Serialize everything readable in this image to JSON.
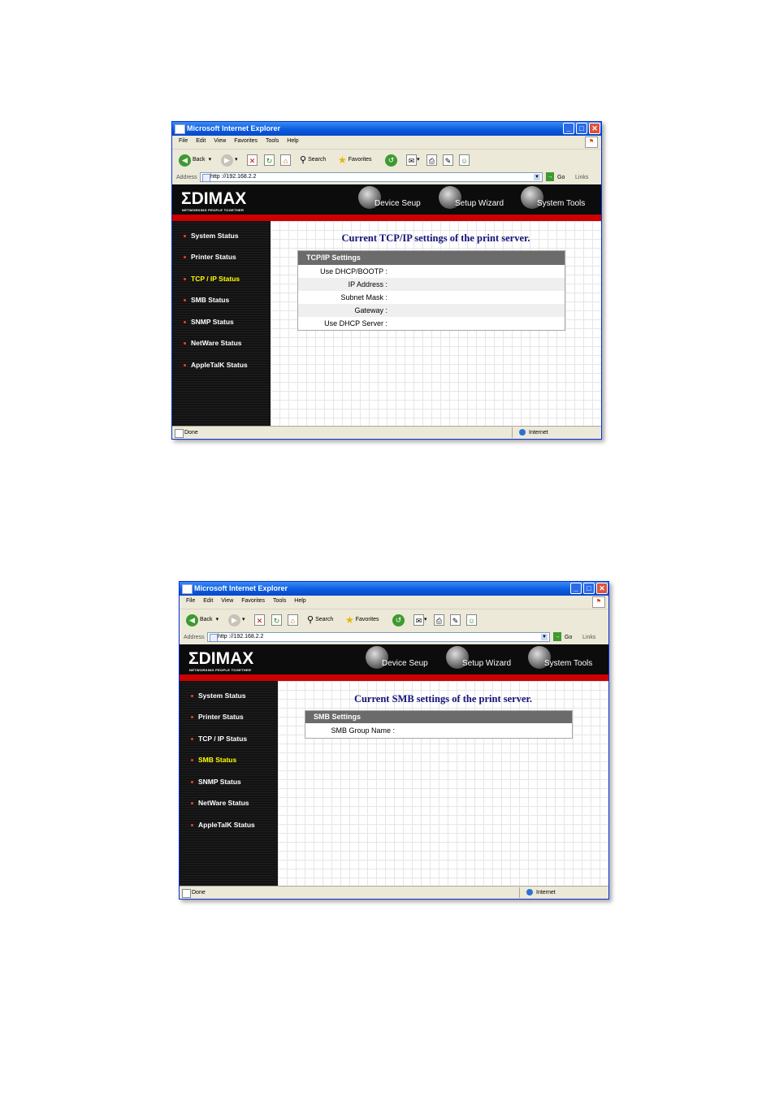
{
  "windows": [
    {
      "title": "Microsoft Internet Explorer",
      "menu": [
        "File",
        "Edit",
        "View",
        "Favorites",
        "Tools",
        "Help"
      ],
      "toolbar": {
        "back": "Back",
        "search": "Search",
        "favorites": "Favorites"
      },
      "address": {
        "label": "Address",
        "url": "http ://192.168.2.2",
        "go": "Go",
        "links": "Links"
      },
      "banner": {
        "logo": "ΣDIMAX",
        "tagline": "NETWORKING PEOPLE TOGETHER",
        "nav": [
          "Device Seup",
          "Setup Wizard",
          "System Tools"
        ]
      },
      "sidebar": [
        "System Status",
        "Printer Status",
        "TCP / IP Status",
        "SMB Status",
        "SNMP Status",
        "NetWare Status",
        "AppleTalK Status"
      ],
      "active_item": "TCP / IP Status",
      "main": {
        "title": "Current TCP/IP settings of the print server.",
        "table_header": "TCP/IP Settings",
        "rows": [
          "Use DHCP/BOOTP :",
          "IP Address :",
          "Subnet Mask :",
          "Gateway :",
          "Use DHCP Server :"
        ]
      },
      "status": {
        "text": "Done",
        "zone": "Internet"
      }
    },
    {
      "title": "Microsoft Internet Explorer",
      "menu": [
        "File",
        "Edit",
        "View",
        "Favorites",
        "Tools",
        "Help"
      ],
      "toolbar": {
        "back": "Back",
        "search": "Search",
        "favorites": "Favorites"
      },
      "address": {
        "label": "Address",
        "url": "http ://192.168.2.2",
        "go": "Go",
        "links": "Links"
      },
      "banner": {
        "logo": "ΣDIMAX",
        "tagline": "NETWORKING PEOPLE TOGETHER",
        "nav": [
          "Device Seup",
          "Setup Wizard",
          "System Tools"
        ]
      },
      "sidebar": [
        "System Status",
        "Printer Status",
        "TCP / IP Status",
        "SMB Status",
        "SNMP Status",
        "NetWare Status",
        "AppleTalK Status"
      ],
      "active_item": "SMB Status",
      "main": {
        "title": "Current SMB settings of the print server.",
        "table_header": "SMB Settings",
        "rows": [
          "SMB Group Name :"
        ]
      },
      "status": {
        "text": "Done",
        "zone": "Internet"
      }
    }
  ],
  "colors": {
    "accent_red": "#cc0000",
    "active_yellow": "#ffff00",
    "title_blue": "#13137a"
  }
}
